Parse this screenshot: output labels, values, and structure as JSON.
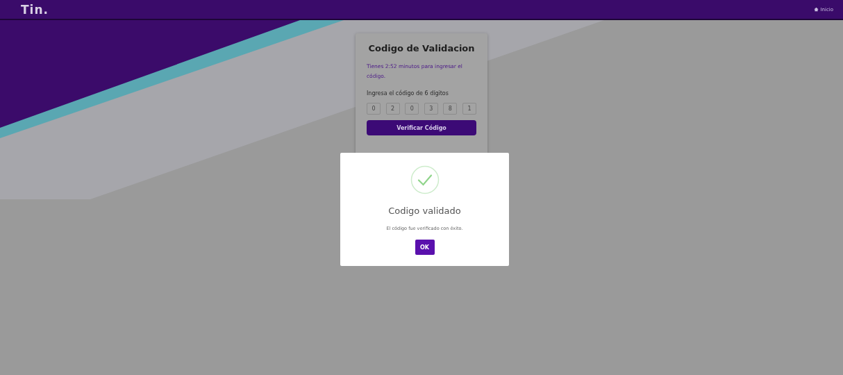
{
  "header": {
    "logo": "Tin.",
    "home_link": "Inicio"
  },
  "card": {
    "title": "Codigo de Validacion",
    "timer_text": "Tienes 2:52 minutos para ingresar el código.",
    "digits_label": "Ingresa el código de 6 dígitos",
    "digits": [
      "0",
      "2",
      "0",
      "3",
      "8",
      "1"
    ],
    "button": "Verificar Código"
  },
  "dialog": {
    "title": "Codigo validado",
    "message": "El código fue verificado con éxito.",
    "button": "OK"
  }
}
